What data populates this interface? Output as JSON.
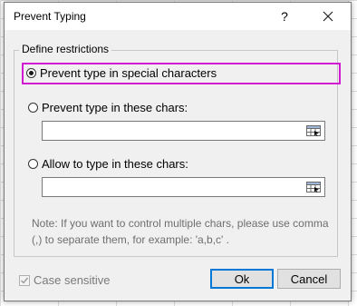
{
  "dialog": {
    "title": "Prevent Typing",
    "help_label": "?"
  },
  "restrictions": {
    "group_label": "Define restrictions",
    "options": [
      {
        "label": "Prevent type in special characters",
        "selected": true
      },
      {
        "label": "Prevent type in these chars:",
        "selected": false,
        "value": ""
      },
      {
        "label": "Allow to type in these chars:",
        "selected": false,
        "value": ""
      }
    ],
    "note": "Note: If you want to control multiple chars, please use comma (,) to separate them, for example:   'a,b,c' ."
  },
  "footer": {
    "case_sensitive_label": "Case sensitive",
    "case_sensitive_checked": true,
    "ok_label": "Ok",
    "cancel_label": "Cancel"
  },
  "colors": {
    "highlight": "#d21ad2",
    "primary_border": "#0078d7"
  },
  "icons": {
    "field_picker": "range-select-icon",
    "close": "close-icon"
  }
}
